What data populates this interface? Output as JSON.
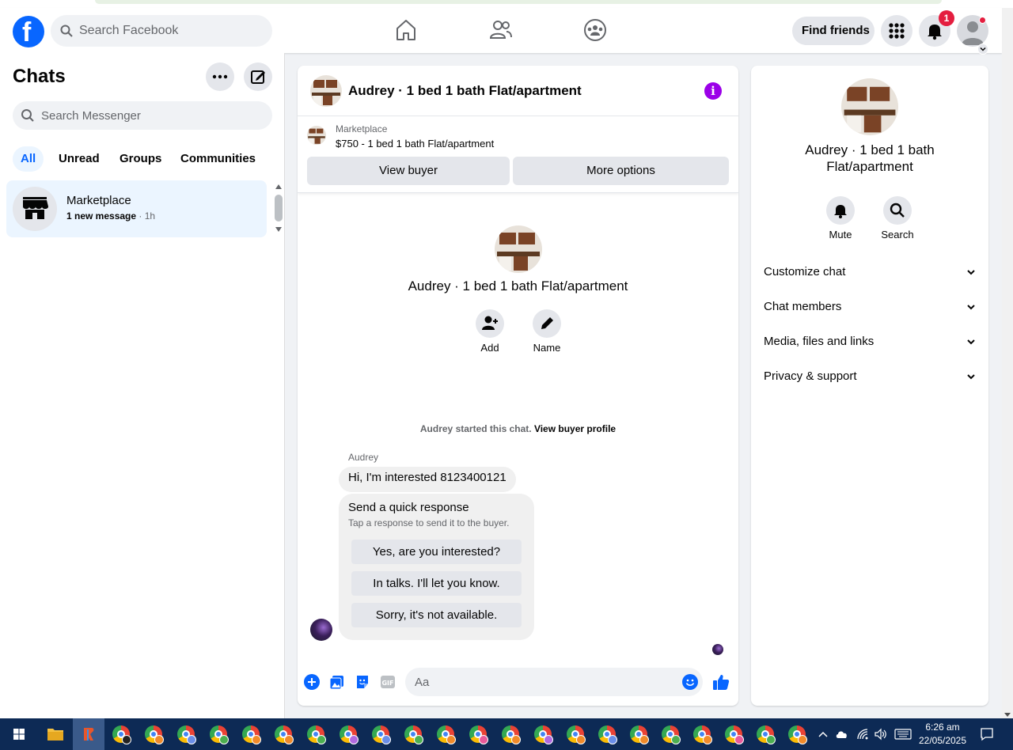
{
  "header": {
    "search_placeholder": "Search Facebook",
    "find_friends_label": "Find friends",
    "notifications_count": "1"
  },
  "sidebar": {
    "title": "Chats",
    "search_placeholder": "Search Messenger",
    "filters": [
      "All",
      "Unread",
      "Groups",
      "Communities"
    ],
    "active_filter": "All",
    "chats": [
      {
        "name": "Marketplace",
        "preview": "1 new message",
        "time": "1h"
      }
    ]
  },
  "thread": {
    "title": "Audrey · 1 bed 1 bath Flat/apartment",
    "listing": {
      "source": "Marketplace",
      "description": "$750 - 1 bed 1 bath Flat/apartment",
      "view_buyer_label": "View buyer",
      "more_options_label": "More options"
    },
    "intro": {
      "title": "Audrey · 1 bed 1 bath Flat/apartment",
      "add_label": "Add",
      "name_label": "Name"
    },
    "system_message": "Audrey started this chat.",
    "system_link": "View buyer profile",
    "sender": "Audrey",
    "message": "Hi, I'm interested 8123400121",
    "quick_response": {
      "title": "Send a quick response",
      "subtitle": "Tap a response to send it to the buyer.",
      "options": [
        "Yes, are you interested?",
        "In talks. I'll let you know.",
        "Sorry, it's not available."
      ]
    },
    "composer_placeholder": "Aa"
  },
  "info_panel": {
    "title": "Audrey · 1 bed 1 bath Flat/apartment",
    "mute_label": "Mute",
    "search_label": "Search",
    "sections": [
      "Customize chat",
      "Chat members",
      "Media, files and links",
      "Privacy & support"
    ]
  },
  "taskbar": {
    "time": "6:26 am",
    "date": "22/05/2025"
  },
  "colors": {
    "brand_blue": "#0866ff",
    "info_purple": "#9b00e8",
    "badge_red": "#e41e3f",
    "taskbar": "#0d2a55"
  }
}
